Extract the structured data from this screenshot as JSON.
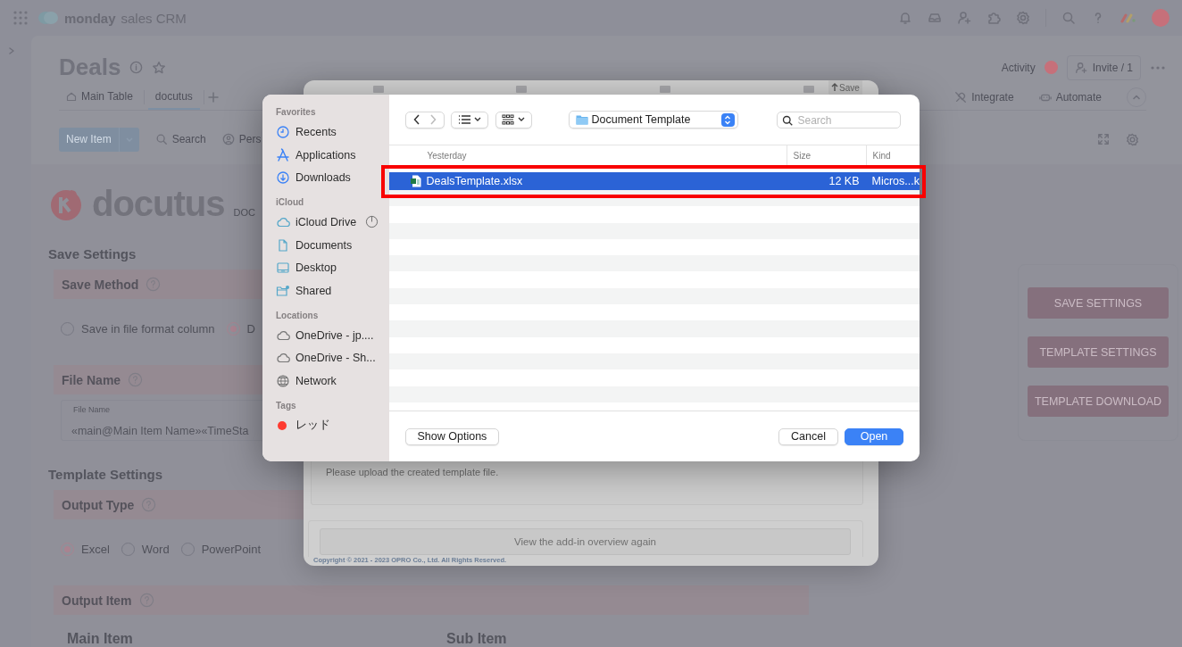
{
  "top_bar": {
    "logo_word": "monday",
    "product": "sales CRM"
  },
  "board": {
    "title": "Deals",
    "activity": "Activity",
    "invite": "Invite / 1",
    "tabs": [
      {
        "label": "Main Table",
        "selected": false
      },
      {
        "label": "docutus",
        "selected": true
      }
    ],
    "actions": [
      "Integrate",
      "Automate"
    ],
    "toolbar": {
      "new_item": "New Item",
      "search": "Search",
      "person": "Pers"
    }
  },
  "addon": {
    "logo": "docutus",
    "logo_suffix": "DOC",
    "save_settings": {
      "heading": "Save Settings",
      "method": {
        "title": "Save Method",
        "options": [
          {
            "label": "Save in file format column",
            "selected": false
          },
          {
            "label": "D",
            "selected": true
          }
        ]
      },
      "file_name": {
        "title": "File Name",
        "field_label": "File Name",
        "value": "«main@Main Item Name»«TimeSta"
      }
    },
    "template_settings": {
      "heading": "Template Settings",
      "output_type": {
        "title": "Output Type",
        "options": [
          {
            "label": "Excel",
            "selected": true
          },
          {
            "label": "Word",
            "selected": false
          },
          {
            "label": "PowerPoint",
            "selected": false
          }
        ]
      },
      "output_item": {
        "title": "Output Item",
        "columns": [
          "Main Item",
          "Sub Item"
        ]
      }
    },
    "buttons": [
      "SAVE SETTINGS",
      "TEMPLATE SETTINGS",
      "TEMPLATE DOWNLOAD"
    ]
  },
  "addin_modal": {
    "save_button": "Save",
    "message": "Please upload the created template file.",
    "overview_button": "View the add-in overview again",
    "copyright": "Copyright © 2021 - 2023 OPRO Co., Ltd. All Rights Reserved."
  },
  "file_dialog": {
    "sidebar": [
      {
        "heading": "Favorites",
        "items": [
          {
            "label": "Recents",
            "kind": "clock",
            "syncing": false
          },
          {
            "label": "Applications",
            "kind": "apps",
            "syncing": false
          },
          {
            "label": "Downloads",
            "kind": "download",
            "syncing": false
          }
        ]
      },
      {
        "heading": "iCloud",
        "items": [
          {
            "label": "iCloud Drive",
            "kind": "cloud",
            "syncing": true
          },
          {
            "label": "Documents",
            "kind": "doc",
            "syncing": false
          },
          {
            "label": "Desktop",
            "kind": "desktop",
            "syncing": false
          },
          {
            "label": "Shared",
            "kind": "shared",
            "syncing": false
          }
        ]
      },
      {
        "heading": "Locations",
        "items": [
          {
            "label": "OneDrive - jp....",
            "kind": "cloud",
            "syncing": false
          },
          {
            "label": "OneDrive - Sh...",
            "kind": "cloud",
            "syncing": false
          },
          {
            "label": "Network",
            "kind": "network",
            "syncing": false
          }
        ]
      },
      {
        "heading": "Tags",
        "items": [
          {
            "label": "レッド",
            "kind": "tag",
            "color": "#fe3b30",
            "syncing": false
          }
        ]
      }
    ],
    "location": "Document Template",
    "search_placeholder": "Search",
    "group_label": "Yesterday",
    "columns": [
      "Size",
      "Kind"
    ],
    "files": [
      {
        "name": "DealsTemplate.xlsx",
        "size": "12 KB",
        "type": "Micros...k",
        "selected": true,
        "highlighted": true
      }
    ],
    "buttons": {
      "options": "Show Options",
      "cancel": "Cancel",
      "open": "Open"
    }
  }
}
